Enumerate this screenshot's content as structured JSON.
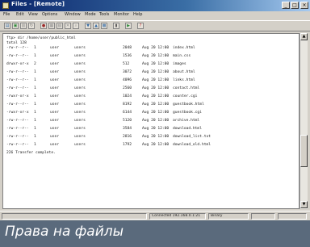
{
  "window": {
    "title": "Files - [Remote]",
    "minimize_glyph": "_",
    "maximize_glyph": "□",
    "close_glyph": "×"
  },
  "menu": {
    "items": [
      "File",
      "Edit",
      "View",
      "Options",
      "Window",
      "Mode",
      "Tools",
      "Monitor",
      "Help"
    ]
  },
  "toolbar": {
    "buttons": [
      {
        "icon": "open-icon",
        "glyph": "▤",
        "color": "#3a6ea5"
      },
      {
        "icon": "connect-icon",
        "glyph": "▣",
        "color": "#2f8a3a"
      },
      {
        "icon": "disconnect-icon",
        "glyph": "▥",
        "color": "#888888"
      },
      {
        "icon": "refresh-icon",
        "glyph": "↻",
        "color": "#666666"
      },
      {
        "icon": "stop-icon",
        "glyph": "●",
        "color": "#9c2a2a"
      },
      {
        "icon": "copy-icon",
        "glyph": "▦",
        "color": "#888888"
      },
      {
        "icon": "paste-icon",
        "glyph": "▧",
        "color": "#888888"
      },
      {
        "icon": "delete-icon",
        "glyph": "✕",
        "color": "#888888"
      },
      {
        "icon": "find-icon",
        "glyph": "⌕",
        "color": "#888888"
      },
      {
        "icon": "download-icon",
        "glyph": "▼",
        "color": "#3a6ea5"
      },
      {
        "icon": "upload-icon",
        "glyph": "▲",
        "color": "#3a6ea5"
      },
      {
        "icon": "properties-icon",
        "glyph": "▩",
        "color": "#3a6ea5"
      },
      {
        "icon": "flag-icon",
        "glyph": "▮",
        "color": "#555555"
      },
      {
        "icon": "go-icon",
        "glyph": "▶",
        "color": "#2f8a3a"
      },
      {
        "icon": "help-icon",
        "glyph": "?",
        "color": "#cc3333"
      }
    ]
  },
  "listing": {
    "header": "ftp> dir /home/user/public_html",
    "subheader": "total 128",
    "rows": [
      {
        "perms": "-rw-r--r--",
        "links": "1",
        "owner": "user",
        "group": "users",
        "size": "2048",
        "date": "Aug 20 12:00",
        "name": "index.html"
      },
      {
        "perms": "-rw-r--r--",
        "links": "1",
        "owner": "user",
        "group": "users",
        "size": "1536",
        "date": "Aug 20 12:00",
        "name": "main.css"
      },
      {
        "perms": "drwxr-xr-x",
        "links": "2",
        "owner": "user",
        "group": "users",
        "size": "512",
        "date": "Aug 20 12:00",
        "name": "images"
      },
      {
        "perms": "-rw-r--r--",
        "links": "1",
        "owner": "user",
        "group": "users",
        "size": "3072",
        "date": "Aug 20 12:00",
        "name": "about.html"
      },
      {
        "perms": "-rw-r--r--",
        "links": "1",
        "owner": "user",
        "group": "users",
        "size": "4096",
        "date": "Aug 20 12:00",
        "name": "links.html"
      },
      {
        "perms": "-rw-r--r--",
        "links": "1",
        "owner": "user",
        "group": "users",
        "size": "2560",
        "date": "Aug 20 12:00",
        "name": "contact.html"
      },
      {
        "perms": "-rwxr-xr-x",
        "links": "1",
        "owner": "user",
        "group": "users",
        "size": "1024",
        "date": "Aug 20 12:00",
        "name": "counter.cgi"
      },
      {
        "perms": "-rw-r--r--",
        "links": "1",
        "owner": "user",
        "group": "users",
        "size": "8192",
        "date": "Aug 20 12:00",
        "name": "guestbook.html"
      },
      {
        "perms": "-rwxr-xr-x",
        "links": "1",
        "owner": "user",
        "group": "users",
        "size": "6144",
        "date": "Aug 20 12:00",
        "name": "guestbook.cgi"
      },
      {
        "perms": "-rw-r--r--",
        "links": "1",
        "owner": "user",
        "group": "users",
        "size": "5120",
        "date": "Aug 20 12:00",
        "name": "archive.html"
      },
      {
        "perms": "-rw-r--r--",
        "links": "1",
        "owner": "user",
        "group": "users",
        "size": "3584",
        "date": "Aug 20 12:00",
        "name": "download.html"
      },
      {
        "perms": "-rw-r--r--",
        "links": "1",
        "owner": "user",
        "group": "users",
        "size": "2816",
        "date": "Aug 20 12:00",
        "name": "download_list.txt"
      },
      {
        "perms": "-rw-r--r--",
        "links": "1",
        "owner": "user",
        "group": "users",
        "size": "1792",
        "date": "Aug 20 12:00",
        "name": "download_old.html"
      }
    ],
    "footer": "226 Transfer complete."
  },
  "statusbar": {
    "connection": "Connected 192.168.0.1:21",
    "mode": "Binary",
    "panes": [
      "",
      "",
      ""
    ]
  },
  "caption": "Права на файлы"
}
